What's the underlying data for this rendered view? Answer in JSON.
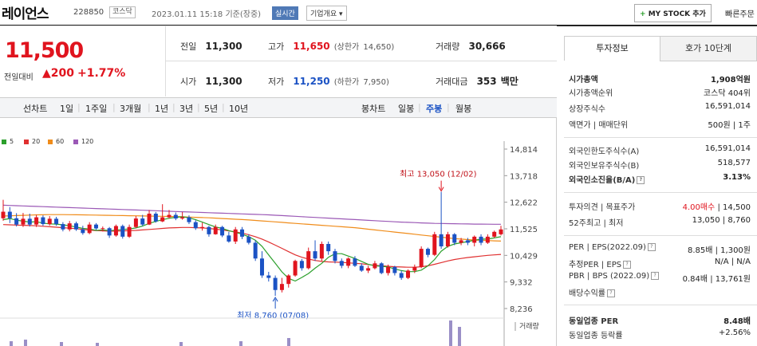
{
  "header": {
    "stock_name": "레이언스",
    "stock_code": "228850",
    "market_tag": "코스닥",
    "datetime": "2023.01.11 15:18",
    "basis": "기준(장중)",
    "realtime_label": "실시간",
    "overview_label": "기업개요",
    "overview_icon": "chevron-down-icon",
    "mystock_label": "MY STOCK 추가",
    "quick_label": "빠른주문"
  },
  "price": {
    "current": "11,500",
    "change_label": "전일대비",
    "change_value": "200",
    "change_direction": "up",
    "change_pct": "+1.77%"
  },
  "quote": {
    "prev_close_label": "전일",
    "prev_close": "11,300",
    "high_label": "고가",
    "high": "11,650",
    "upper_limit_label": "(상한가",
    "upper_limit": "14,650)",
    "volume_label": "거래량",
    "volume": "30,666",
    "open_label": "시가",
    "open": "11,300",
    "low_label": "저가",
    "low": "11,250",
    "lower_limit_label": "(하한가",
    "lower_limit": "7,950)",
    "amount_label": "거래대금",
    "amount": "353",
    "amount_unit": "백만"
  },
  "chart_tabs": {
    "line_label": "선차트",
    "line_periods": [
      "1일",
      "1주일",
      "3개월",
      "1년",
      "3년",
      "5년",
      "10년"
    ],
    "candle_label": "봉차트",
    "candle_periods": [
      "일봉",
      "주봉",
      "월봉"
    ],
    "active_candle": "주봉"
  },
  "chart_legend": [
    {
      "label": "5",
      "color": "#2ca02c"
    },
    {
      "label": "20",
      "color": "#e03030"
    },
    {
      "label": "60",
      "color": "#f08c1a"
    },
    {
      "label": "120",
      "color": "#9b59b6"
    }
  ],
  "chart_data": {
    "type": "candlestick",
    "yticks": [
      "14,814",
      "13,718",
      "12,622",
      "11,525",
      "10,429",
      "9,332",
      "8,236"
    ],
    "ylim": [
      8236,
      14814
    ],
    "high_annotation": "최고 13,050 (12/02)",
    "low_annotation": "최저 8,760 (07/08)",
    "volume_label": "거래량",
    "candles": [
      [
        11960,
        12230,
        12720,
        11860
      ],
      [
        12230,
        11960,
        12420,
        11760
      ],
      [
        11960,
        11700,
        12170,
        11620
      ],
      [
        11700,
        11940,
        12180,
        11600
      ],
      [
        11940,
        11700,
        12150,
        11620
      ],
      [
        11700,
        12000,
        12100,
        11600
      ],
      [
        12000,
        11720,
        12080,
        11650
      ],
      [
        11720,
        11940,
        12050,
        11660
      ],
      [
        11940,
        11720,
        12020,
        11650
      ],
      [
        11720,
        11500,
        11800,
        11420
      ],
      [
        11500,
        11750,
        11850,
        11420
      ],
      [
        11750,
        11500,
        11820,
        11440
      ],
      [
        11500,
        11350,
        11650,
        11280
      ],
      [
        11350,
        11700,
        11800,
        11300
      ],
      [
        11700,
        11540,
        11760,
        11480
      ],
      [
        11540,
        11550,
        11620,
        11420
      ],
      [
        11550,
        11250,
        11600,
        11150
      ],
      [
        11250,
        11640,
        11700,
        11200
      ],
      [
        11640,
        11200,
        11700,
        11120
      ],
      [
        11200,
        11600,
        11700,
        11150
      ],
      [
        11600,
        11950,
        12050,
        11550
      ],
      [
        11950,
        11700,
        12100,
        11640
      ],
      [
        11700,
        12150,
        12300,
        11680
      ],
      [
        12150,
        11830,
        12220,
        11780
      ],
      [
        11830,
        12000,
        12540,
        11800
      ],
      [
        12000,
        12100,
        12300,
        11950
      ],
      [
        12100,
        11950,
        12200,
        11880
      ],
      [
        11950,
        12000,
        12220,
        11900
      ],
      [
        12000,
        11800,
        12080,
        11720
      ],
      [
        11800,
        11550,
        11880,
        11480
      ],
      [
        11550,
        11600,
        11780,
        11450
      ],
      [
        11600,
        11300,
        11650,
        11200
      ],
      [
        11300,
        11600,
        11700,
        11280
      ],
      [
        11600,
        11250,
        11650,
        11180
      ],
      [
        11250,
        11000,
        11400,
        10950
      ],
      [
        11000,
        11500,
        11600,
        10900
      ],
      [
        11500,
        11200,
        11600,
        11100
      ],
      [
        11200,
        10950,
        11300,
        10880
      ],
      [
        10950,
        10300,
        11050,
        10200
      ],
      [
        10300,
        9600,
        10600,
        9500
      ],
      [
        9600,
        9500,
        9750,
        9350
      ],
      [
        9500,
        9000,
        9600,
        8760
      ],
      [
        9000,
        9250,
        9500,
        8900
      ],
      [
        9250,
        9600,
        9650,
        9100
      ],
      [
        9600,
        10200,
        10250,
        9550
      ],
      [
        10200,
        9900,
        10280,
        9800
      ],
      [
        9900,
        10600,
        10750,
        9850
      ],
      [
        10600,
        10300,
        11050,
        10200
      ],
      [
        10300,
        10900,
        11000,
        10200
      ],
      [
        10900,
        10600,
        11000,
        10450
      ],
      [
        10600,
        10200,
        10700,
        10100
      ],
      [
        10200,
        10000,
        10300,
        9900
      ],
      [
        10000,
        10300,
        10350,
        9900
      ],
      [
        10300,
        10000,
        10400,
        9950
      ],
      [
        10000,
        9800,
        10100,
        9750
      ],
      [
        9800,
        9900,
        10000,
        9700
      ],
      [
        9900,
        10100,
        10200,
        9850
      ],
      [
        10100,
        9700,
        10150,
        9650
      ],
      [
        9700,
        9950,
        10050,
        9600
      ],
      [
        9950,
        9700,
        10000,
        9600
      ],
      [
        9700,
        9500,
        9800,
        9420
      ],
      [
        9500,
        9800,
        9850,
        9450
      ],
      [
        9800,
        9950,
        10050,
        9700
      ],
      [
        9950,
        10700,
        10800,
        9900
      ],
      [
        10700,
        10450,
        10750,
        10350
      ],
      [
        10450,
        11300,
        11400,
        10400
      ],
      [
        11300,
        10800,
        13050,
        10700
      ],
      [
        10800,
        11300,
        11400,
        10750
      ],
      [
        11300,
        10950,
        11350,
        10850
      ],
      [
        10950,
        11050,
        11150,
        10850
      ],
      [
        11050,
        10950,
        11150,
        10850
      ],
      [
        10950,
        11200,
        11250,
        10800
      ],
      [
        11200,
        10950,
        11300,
        10850
      ],
      [
        10950,
        11200,
        11300,
        10900
      ],
      [
        11200,
        11400,
        11450,
        11150
      ],
      [
        11300,
        11500,
        11650,
        11250
      ]
    ],
    "ma5": [
      11900,
      11950,
      11880,
      11840,
      11800,
      11820,
      11760,
      11730,
      11720,
      11690,
      11650,
      11600,
      11540,
      11520,
      11460,
      11480,
      11450,
      11470,
      11500,
      11520,
      11560,
      11640,
      11750,
      11830,
      11900,
      11960,
      12000,
      12020,
      11980,
      11900,
      11800,
      11700,
      11600,
      11540,
      11450,
      11380,
      11300,
      11200,
      11050,
      10800,
      10450,
      10100,
      9750,
      9480,
      9370,
      9520,
      9680,
      9900,
      10100,
      10350,
      10500,
      10500,
      10400,
      10300,
      10180,
      10060,
      10000,
      9980,
      9950,
      9870,
      9800,
      9760,
      9760,
      9820,
      10000,
      10260,
      10600,
      10800,
      10900,
      10950,
      11000,
      11050,
      11100,
      11100,
      11150,
      11200
    ],
    "ma20": [
      11700,
      11690,
      11680,
      11670,
      11660,
      11650,
      11630,
      11610,
      11590,
      11570,
      11550,
      11530,
      11500,
      11470,
      11450,
      11440,
      11430,
      11430,
      11440,
      11450,
      11460,
      11480,
      11500,
      11520,
      11540,
      11560,
      11570,
      11580,
      11580,
      11570,
      11560,
      11540,
      11510,
      11480,
      11440,
      11400,
      11350,
      11280,
      11200,
      11100,
      10980,
      10850,
      10720,
      10580,
      10450,
      10350,
      10280,
      10220,
      10180,
      10160,
      10150,
      10140,
      10120,
      10100,
      10080,
      10050,
      10020,
      10000,
      9980,
      9960,
      9950,
      9940,
      9940,
      9960,
      10000,
      10060,
      10130,
      10200,
      10260,
      10300,
      10340,
      10370,
      10400,
      10430,
      10450,
      10470
    ],
    "ma60": [
      12050,
      12060,
      12070,
      12080,
      12090,
      12100,
      12105,
      12110,
      12110,
      12110,
      12108,
      12105,
      12100,
      12095,
      12090,
      12085,
      12080,
      12075,
      12070,
      12065,
      12060,
      12055,
      12050,
      12045,
      12040,
      12035,
      12030,
      12020,
      12010,
      12000,
      11990,
      11980,
      11965,
      11950,
      11935,
      11920,
      11905,
      11890,
      11870,
      11850,
      11830,
      11810,
      11790,
      11770,
      11750,
      11730,
      11710,
      11690,
      11670,
      11650,
      11630,
      11610,
      11590,
      11570,
      11540,
      11510,
      11480,
      11450,
      11420,
      11390,
      11360,
      11330,
      11300,
      11270,
      11240,
      11210,
      11180,
      11150,
      11120,
      11100,
      11080,
      11060,
      11050,
      11040,
      11030,
      11020
    ],
    "ma120": [
      12500,
      12490,
      12480,
      12470,
      12460,
      12450,
      12440,
      12430,
      12420,
      12410,
      12400,
      12390,
      12380,
      12370,
      12360,
      12350,
      12340,
      12330,
      12320,
      12310,
      12300,
      12290,
      12280,
      12270,
      12260,
      12250,
      12240,
      12230,
      12220,
      12210,
      12200,
      12190,
      12180,
      12170,
      12160,
      12150,
      12140,
      12130,
      12120,
      12110,
      12100,
      12085,
      12070,
      12055,
      12040,
      12025,
      12010,
      11995,
      11980,
      11965,
      11950,
      11935,
      11920,
      11905,
      11890,
      11875,
      11860,
      11845,
      11830,
      11815,
      11800,
      11790,
      11780,
      11770,
      11760,
      11750,
      11745,
      11740,
      11735,
      11730,
      11725,
      11720,
      11718,
      11716,
      11714,
      11712
    ]
  },
  "panel": {
    "tab_invest": "투자정보",
    "tab_orderbook": "호가 10단계",
    "rows": [
      {
        "k": "시가총액",
        "v": "1,908억원",
        "bold": true
      },
      {
        "k": "시가총액순위",
        "v": "코스닥 404위"
      },
      {
        "k": "상장주식수",
        "v": "16,591,014"
      },
      {
        "k": "액면가 | 매매단위",
        "v": "500원 | 1주"
      },
      {
        "k": "외국인한도주식수(A)",
        "v": "16,591,014"
      },
      {
        "k": "외국인보유주식수(B)",
        "v": "518,577"
      },
      {
        "k": "외국인소진율(B/A)",
        "v": "3.13%",
        "bold": true
      },
      {
        "k": "투자의견 | 목표주가",
        "v_red": "4.00매수",
        "v": "| 14,500"
      },
      {
        "k": "52주최고 | 최저",
        "v": "13,050 | 8,760"
      },
      {
        "k": "PER | EPS(2022.09)",
        "v": "8.85배 | 1,300원"
      },
      {
        "k": "추정PER | EPS",
        "v": "N/A | N/A"
      },
      {
        "k": "PBR | BPS (2022.09)",
        "v": "0.84배 | 13,761원"
      },
      {
        "k": "배당수익률",
        "v": ""
      },
      {
        "k": "동일업종 PER",
        "v": "8.48배",
        "bold": true
      },
      {
        "k": "동일업종 등락률",
        "v": "+2.56%",
        "red": true
      }
    ]
  }
}
